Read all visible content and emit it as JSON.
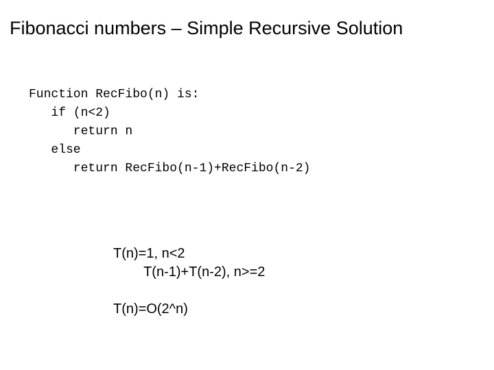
{
  "title": "Fibonacci numbers – Simple Recursive Solution",
  "code": {
    "line1": "Function RecFibo(n) is:",
    "line2": "   if (n<2)",
    "line3": "      return n",
    "line4": "   else",
    "line5": "      return RecFibo(n-1)+RecFibo(n-2)"
  },
  "complexity": {
    "line1": "T(n)=1, n<2",
    "line2": "        T(n-1)+T(n-2), n>=2",
    "line3": "",
    "line4": "T(n)=O(2^n)"
  }
}
